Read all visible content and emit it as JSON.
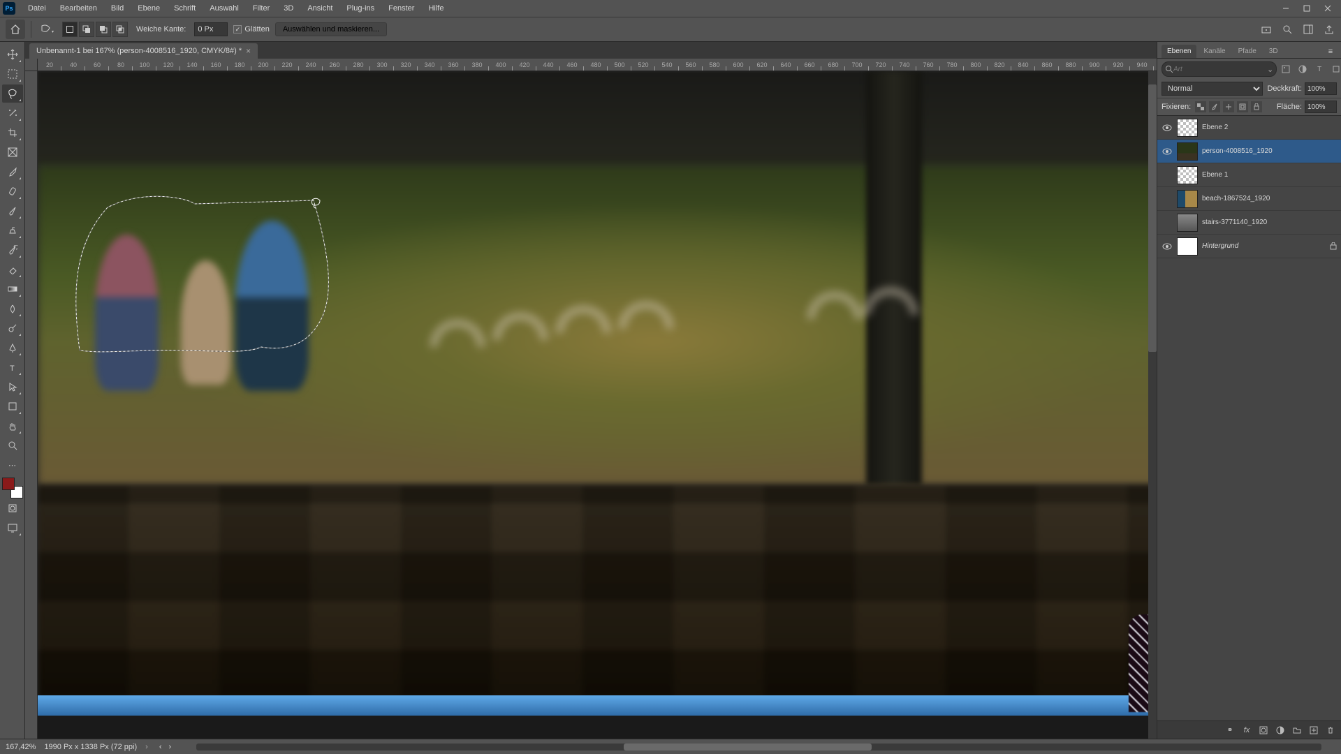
{
  "app": {
    "logo": "Ps"
  },
  "menu": {
    "items": [
      "Datei",
      "Bearbeiten",
      "Bild",
      "Ebene",
      "Schrift",
      "Auswahl",
      "Filter",
      "3D",
      "Ansicht",
      "Plug-ins",
      "Fenster",
      "Hilfe"
    ]
  },
  "options": {
    "feather_label": "Weiche Kante:",
    "feather_value": "0 Px",
    "antialias_label": "Glätten",
    "select_mask_label": "Auswählen und maskieren..."
  },
  "document": {
    "tab_title": "Unbenannt-1 bei 167% (person-4008516_1920, CMYK/8#) *"
  },
  "ruler": {
    "marks": [
      "20",
      "40",
      "60",
      "80",
      "100",
      "120",
      "140",
      "160",
      "180",
      "200",
      "220",
      "240",
      "260",
      "280",
      "300",
      "320",
      "340",
      "360",
      "380",
      "400",
      "420",
      "440",
      "460",
      "480",
      "500",
      "520",
      "540",
      "560",
      "580",
      "600",
      "620",
      "640",
      "660",
      "680",
      "700",
      "720",
      "740",
      "760",
      "780",
      "800",
      "820",
      "840",
      "860",
      "880",
      "900",
      "920",
      "940"
    ]
  },
  "panels": {
    "tabs": [
      "Ebenen",
      "Kanäle",
      "Pfade",
      "3D"
    ],
    "search_placeholder": "Art",
    "blend_mode": "Normal",
    "opacity_label": "Deckkraft:",
    "opacity_value": "100%",
    "lock_label": "Fixieren:",
    "fill_label": "Fläche:",
    "fill_value": "100%",
    "layers": [
      {
        "name": "Ebene 2",
        "visible": true,
        "thumb": "checker",
        "italic": false,
        "selected": false,
        "locked": false
      },
      {
        "name": "person-4008516_1920",
        "visible": true,
        "thumb": "img1",
        "italic": false,
        "selected": true,
        "locked": false
      },
      {
        "name": "Ebene 1",
        "visible": false,
        "thumb": "checker",
        "italic": false,
        "selected": false,
        "locked": false
      },
      {
        "name": "beach-1867524_1920",
        "visible": false,
        "thumb": "img2",
        "italic": false,
        "selected": false,
        "locked": false
      },
      {
        "name": "stairs-3771140_1920",
        "visible": false,
        "thumb": "img3",
        "italic": false,
        "selected": false,
        "locked": false
      },
      {
        "name": "Hintergrund",
        "visible": true,
        "thumb": "white",
        "italic": true,
        "selected": false,
        "locked": true
      }
    ]
  },
  "status": {
    "zoom": "167,42%",
    "info": "1990 Px x 1338 Px (72 ppi)"
  }
}
